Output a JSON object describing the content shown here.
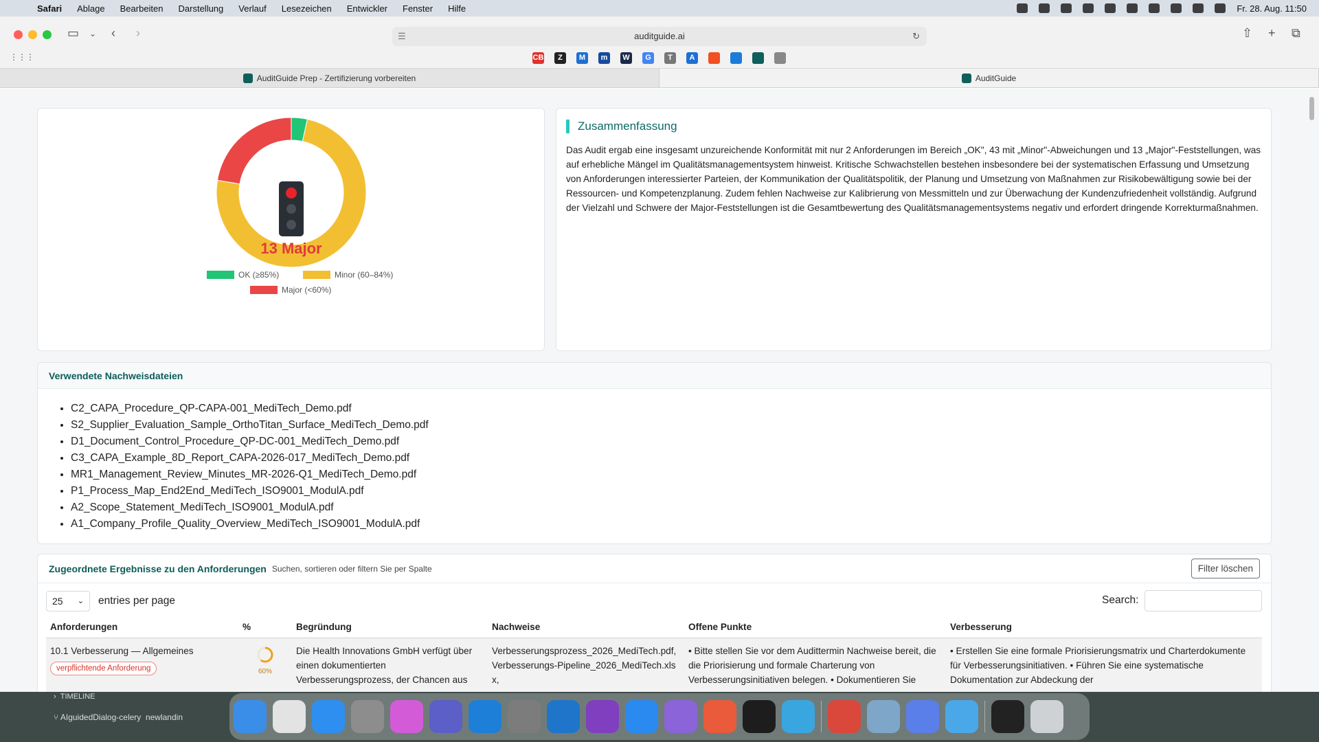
{
  "menubar": {
    "app": "Safari",
    "items": [
      "Ablage",
      "Bearbeiten",
      "Darstellung",
      "Verlauf",
      "Lesezeichen",
      "Entwickler",
      "Fenster",
      "Hilfe"
    ],
    "clock": "Fr. 28. Aug.  11:50"
  },
  "browser": {
    "url": "auditguide.ai",
    "tabs": [
      {
        "title": "AuditGuide Prep - Zertifizierung vorbereiten"
      },
      {
        "title": "AuditGuide"
      }
    ],
    "favorites": [
      {
        "name": "cb-icon",
        "label": "CB",
        "color": "#e0312a"
      },
      {
        "name": "z-icon",
        "label": "Z",
        "color": "#222222"
      },
      {
        "name": "m-icon",
        "label": "M",
        "color": "#1e6fd0"
      },
      {
        "name": "m2-icon",
        "label": "m",
        "color": "#174a9c"
      },
      {
        "name": "w-icon",
        "label": "W",
        "color": "#1b2a4a"
      },
      {
        "name": "google-icon",
        "label": "G",
        "color": "#4285f4"
      },
      {
        "name": "t-icon",
        "label": "T",
        "color": "#777777"
      },
      {
        "name": "a-icon",
        "label": "A",
        "color": "#1f6fd3"
      },
      {
        "name": "ms-icon",
        "label": "",
        "color": "#f25022"
      },
      {
        "name": "blue-icon",
        "label": "",
        "color": "#1d7bd8"
      },
      {
        "name": "ag-icon",
        "label": "",
        "color": "#0f5f5c"
      },
      {
        "name": "globe-icon",
        "label": "",
        "color": "#888888"
      }
    ]
  },
  "donut": {
    "center_label": "13 Major",
    "legend": [
      {
        "label": "OK (≥85%)",
        "color": "#22c475"
      },
      {
        "label": "Minor (60–84%)",
        "color": "#f2bf33"
      },
      {
        "label": "Major (<60%)",
        "color": "#ea4646"
      }
    ]
  },
  "chart_data": {
    "type": "pie",
    "categories": [
      "OK (≥85%)",
      "Minor (60–84%)",
      "Major (<60%)"
    ],
    "values": [
      2,
      43,
      13
    ],
    "colors": [
      "#22c475",
      "#f2bf33",
      "#ea4646"
    ],
    "title": ""
  },
  "summary": {
    "title": "Zusammenfassung",
    "text": "Das Audit ergab eine insgesamt unzureichende Konformität mit nur 2 Anforderungen im Bereich „OK\", 43 mit „Minor\"-Abweichungen und 13 „Major\"-Feststellungen, was auf erhebliche Mängel im Qualitätsmanagementsystem hinweist. Kritische Schwachstellen bestehen insbesondere bei der systematischen Erfassung und Umsetzung von Anforderungen interessierter Parteien, der Kommunikation der Qualitätspolitik, der Planung und Umsetzung von Maßnahmen zur Risikobewältigung sowie bei der Ressourcen- und Kompetenzplanung. Zudem fehlen Nachweise zur Kalibrierung von Messmitteln und zur Überwachung der Kundenzufriedenheit vollständig. Aufgrund der Vielzahl und Schwere der Major-Feststellungen ist die Gesamtbewertung des Qualitätsmanagementsystems negativ und erfordert dringende Korrekturmaßnahmen."
  },
  "files": {
    "title": "Verwendete Nachweisdateien",
    "items": [
      "C2_CAPA_Procedure_QP-CAPA-001_MediTech_Demo.pdf",
      "S2_Supplier_Evaluation_Sample_OrthoTitan_Surface_MediTech_Demo.pdf",
      "D1_Document_Control_Procedure_QP-DC-001_MediTech_Demo.pdf",
      "C3_CAPA_Example_8D_Report_CAPA-2026-017_MediTech_Demo.pdf",
      "MR1_Management_Review_Minutes_MR-2026-Q1_MediTech_Demo.pdf",
      "P1_Process_Map_End2End_MediTech_ISO9001_ModulA.pdf",
      "A2_Scope_Statement_MediTech_ISO9001_ModulA.pdf",
      "A1_Company_Profile_Quality_Overview_MediTech_ISO9001_ModulA.pdf"
    ]
  },
  "requirements": {
    "title": "Zugeordnete Ergebnisse zu den Anforderungen",
    "subtitle": "Suchen, sortieren oder filtern Sie per Spalte",
    "clear_filter": "Filter löschen",
    "page_length": "25",
    "page_length_label": "entries per page",
    "search_label": "Search:",
    "columns": [
      "Anforderungen",
      "%",
      "Begründung",
      "Nachweise",
      "Offene Punkte",
      "Verbesserung"
    ],
    "rows": [
      {
        "requirement": "10.1 Verbesserung — Allgemeines",
        "badge": "verpflichtende Anforderung",
        "percent_label": "60%",
        "percent": 60,
        "reason": "Die Health Innovations GmbH verfügt über einen dokumentierten Verbesserungsprozess, der Chancen aus",
        "evidence": "Verbesserungsprozess_2026_MediTech.pdf, Verbesserungs-Pipeline_2026_MediTech.xlsx,",
        "open_points": "• Bitte stellen Sie vor dem Audittermin Nachweise bereit, die die Priorisierung und formale Charterung von Verbesserungsinitiativen belegen. • Dokumentieren Sie",
        "improvement": "• Erstellen Sie eine formale Priorisierungsmatrix und Charterdokumente für Verbesserungsinitiativen. • Führen Sie eine systematische Dokumentation zur Abdeckung der"
      }
    ]
  },
  "dock": {
    "timeline_label": "TIMELINE",
    "branch_label": "AIguidedDialog-celery",
    "branch2_label": "newlandin"
  }
}
